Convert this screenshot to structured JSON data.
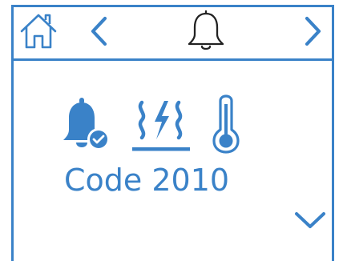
{
  "header": {
    "home_icon": "home-icon",
    "prev_icon": "chevron-left-icon",
    "title_icon": "bell-outline-icon",
    "next_icon": "chevron-right-icon"
  },
  "status": {
    "icons": [
      "bell-check-icon",
      "floor-heating-icon",
      "thermometer-icon"
    ],
    "code": "Code 2010"
  },
  "footer": {
    "down_icon": "chevron-down-icon"
  },
  "colors": {
    "accent": "#3a82c8",
    "outline": "#222222",
    "background": "#ffffff"
  }
}
